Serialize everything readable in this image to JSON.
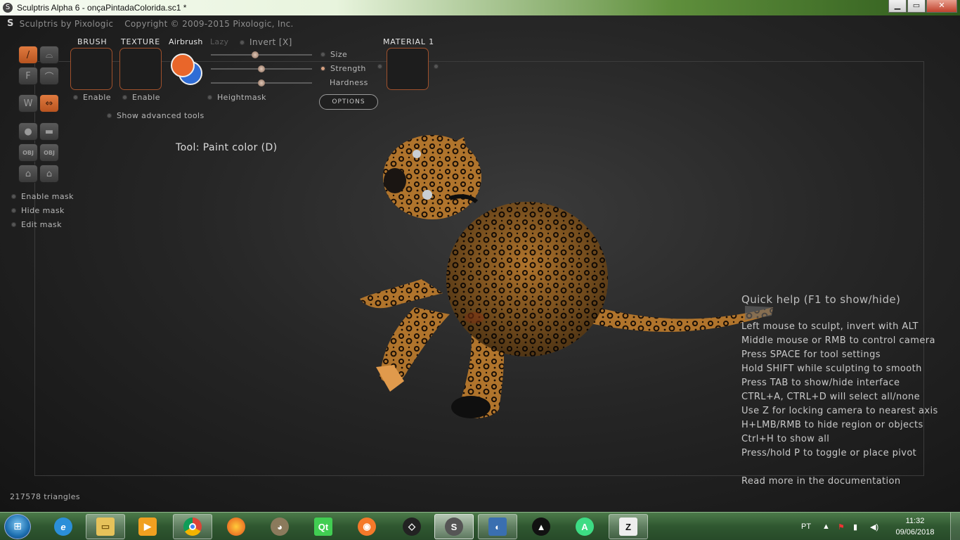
{
  "window": {
    "title": "Sculptris Alpha 6 - onçaPintadaColorida.sc1 *",
    "minimize": "▁",
    "maximize": "▭",
    "close": "✕"
  },
  "header": {
    "app_name": "Sculptris by Pixologic",
    "copyright": "Copyright © 2009-2015 Pixologic, Inc."
  },
  "left_tools": {
    "mask_options": [
      "Enable mask",
      "Hide mask",
      "Edit mask"
    ],
    "labels": {
      "flatten": "F",
      "obj": "OBJ"
    }
  },
  "panel": {
    "brush_title": "BRUSH",
    "texture_title": "TEXTURE",
    "airbrush_label": "Airbrush",
    "lazy_label": "Lazy",
    "invert_label": "Invert [X]",
    "brush_enable": "Enable",
    "texture_enable": "Enable",
    "heightmask_label": "Heightmask",
    "advanced_label": "Show advanced tools",
    "size_label": "Size",
    "strength_label": "Strength",
    "hardness_label": "Hardness",
    "options_button": "OPTIONS",
    "material_title": "MATERIAL 1",
    "primary_color": "#e9662a",
    "secondary_color": "#2f6dd6",
    "accent_color": "#d8703c"
  },
  "status": {
    "tool": "Tool: Paint color (D)",
    "triangles": "217578 triangles"
  },
  "quick_help": {
    "title": "Quick help (F1 to show/hide)",
    "lines": [
      "Left mouse to sculpt, invert with ALT",
      "Middle mouse or RMB to control camera",
      "Press SPACE for tool settings",
      "Hold SHIFT while sculpting to smooth",
      "Press TAB to show/hide interface",
      "CTRL+A, CTRL+D will select all/none",
      "Use Z for locking camera to nearest axis",
      "H+LMB/RMB to hide region or objects",
      "Ctrl+H to show all",
      "Press/hold P to toggle or place pivot"
    ],
    "doc_link": "Read more in the documentation"
  },
  "taskbar": {
    "apps": [
      "internet-explorer",
      "file-explorer",
      "media-player",
      "chrome",
      "firefox",
      "gimp",
      "qt-creator",
      "blender",
      "unity",
      "sculptris",
      "photo-app",
      "inkscape",
      "android-studio",
      "zbrush"
    ],
    "qt_label": "Qt",
    "language": "PT",
    "time": "11:32",
    "date": "09/06/2018"
  }
}
